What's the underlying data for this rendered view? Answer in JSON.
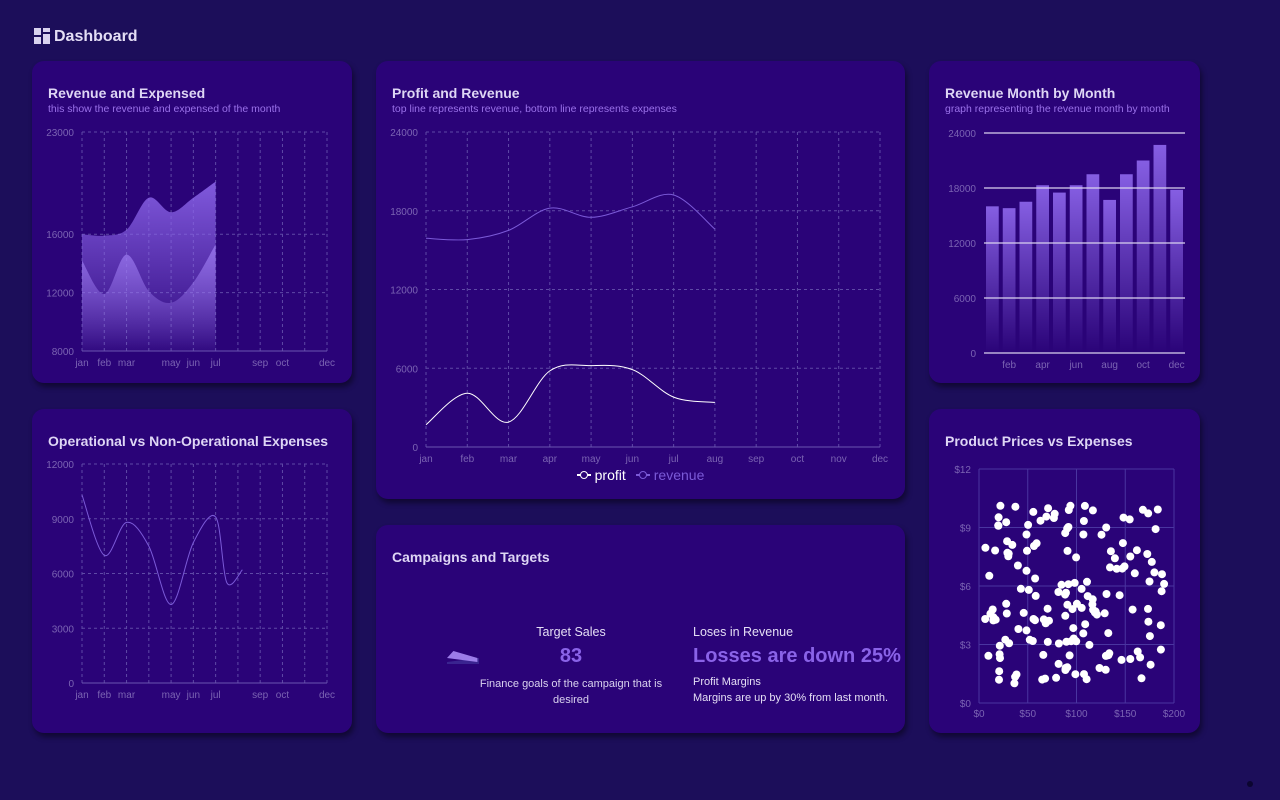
{
  "app": {
    "title": "Dashboard",
    "logo_icon": "dashboard-grid-icon"
  },
  "theme": {
    "background": "#1c0e5a",
    "card": "#2a0378",
    "accent": "#8a63e8",
    "line_light": "#ffffff",
    "line_purple": "#7b5ad8"
  },
  "cards": {
    "rev_exp": {
      "title": "Revenue and Expensed",
      "subtitle": "this show the revenue and expensed of the month"
    },
    "profit_rev": {
      "title": "Profit and Revenue",
      "subtitle": "top line represents revenue, bottom line represents expenses"
    },
    "rev_month": {
      "title": "Revenue Month by Month",
      "subtitle": "graph representing the revenue month by month"
    },
    "op_nonop": {
      "title": "Operational vs Non-Operational Expenses"
    },
    "campaigns": {
      "title": "Campaigns and Targets",
      "target_label": "Target Sales",
      "target_value": "83",
      "target_desc": "Finance goals of the campaign that is desired",
      "loses_label": "Loses in Revenue",
      "loses_value": "Losses are down 25%",
      "margins_label": "Profit Margins",
      "margins_desc": "Margins are up by 30% from last month.",
      "progress_fraction": 0.83
    },
    "prices": {
      "title": "Product Prices vs Expenses"
    }
  },
  "chart_data": [
    {
      "id": "rev_exp",
      "type": "area",
      "x_ticks": [
        "jan",
        "feb",
        "mar",
        "",
        "may",
        "jun",
        "jul",
        "",
        "sep",
        "oct",
        "",
        "dec"
      ],
      "y_ticks": [
        8000,
        12000,
        16000,
        23000
      ],
      "ylim": [
        8000,
        23000
      ],
      "grid": true,
      "series": [
        {
          "values": [
            16000,
            15900,
            16300,
            18500,
            17500,
            18500,
            19600
          ]
        },
        {
          "values": [
            14200,
            11900,
            14600,
            12100,
            11300,
            12700,
            15300
          ]
        }
      ]
    },
    {
      "id": "profit_rev",
      "type": "line",
      "categories": [
        "jan",
        "feb",
        "mar",
        "apr",
        "may",
        "jun",
        "jul",
        "aug",
        "sep",
        "oct",
        "nov",
        "dec"
      ],
      "y_ticks": [
        0,
        6000,
        12000,
        18000,
        24000
      ],
      "ylim": [
        0,
        24000
      ],
      "grid": true,
      "legend_position": "bottom",
      "series": [
        {
          "name": "profit",
          "color": "#ffffff",
          "values": [
            1700,
            4100,
            1900,
            5800,
            6200,
            5900,
            3800,
            3400
          ]
        },
        {
          "name": "revenue",
          "color": "#7b5ad8",
          "values": [
            15900,
            15800,
            16500,
            18200,
            17500,
            18300,
            19200,
            16600
          ]
        }
      ]
    },
    {
      "id": "rev_month",
      "type": "bar",
      "categories": [
        "jan",
        "feb",
        "mar",
        "apr",
        "may",
        "jun",
        "jul",
        "aug",
        "sep",
        "oct",
        "nov",
        "dec"
      ],
      "x_ticks": [
        "",
        "feb",
        "",
        "apr",
        "",
        "jun",
        "",
        "aug",
        "",
        "oct",
        "",
        "dec"
      ],
      "y_ticks": [
        0,
        6000,
        12000,
        18000,
        24000
      ],
      "ylim": [
        0,
        24000
      ],
      "values": [
        16000,
        15800,
        16500,
        18300,
        17500,
        18300,
        19500,
        16700,
        19500,
        21000,
        22700,
        17800
      ]
    },
    {
      "id": "op_nonop",
      "type": "line",
      "x_ticks": [
        "jan",
        "feb",
        "mar",
        "",
        "may",
        "jun",
        "jul",
        "",
        "sep",
        "oct",
        "",
        "dec"
      ],
      "y_ticks": [
        0,
        3000,
        6000,
        9000,
        12000
      ],
      "ylim": [
        0,
        12000
      ],
      "grid": true,
      "series": [
        {
          "color": "#7b5ad8",
          "x": [
            0,
            1,
            2,
            3,
            4,
            5,
            6,
            6.5,
            7.2
          ],
          "values": [
            10300,
            7000,
            8800,
            7500,
            4300,
            7700,
            9100,
            5500,
            6200
          ]
        }
      ]
    },
    {
      "id": "prices",
      "type": "scatter",
      "x_ticks": [
        "$0",
        "$50",
        "$100",
        "$150",
        "$200"
      ],
      "y_ticks": [
        "$0",
        "$3",
        "$6",
        "$9",
        "$12"
      ],
      "xlim": [
        0,
        200
      ],
      "ylim": [
        0,
        12
      ],
      "grid": true
    }
  ]
}
